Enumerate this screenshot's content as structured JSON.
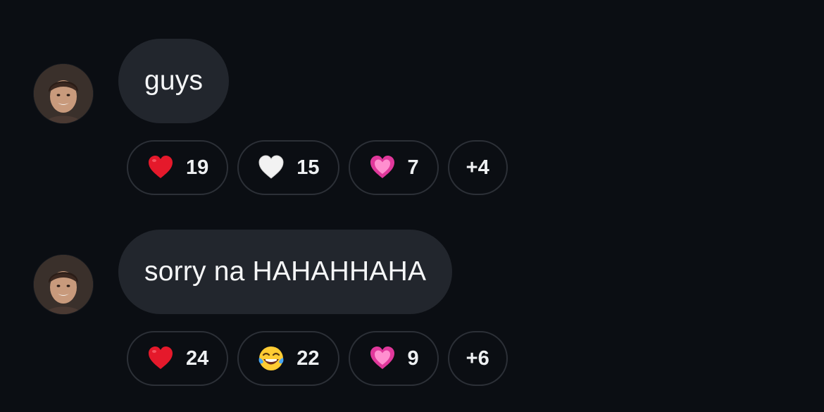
{
  "messages": [
    {
      "avatar": "user-photo-avatar",
      "text": "guys",
      "reactions": [
        {
          "emoji": "red-heart",
          "count": "19"
        },
        {
          "emoji": "white-heart",
          "count": "15"
        },
        {
          "emoji": "pink-heart",
          "count": "7"
        }
      ],
      "more": "+4"
    },
    {
      "avatar": "user-photo-avatar",
      "text": "sorry na HAHAHHAHA",
      "reactions": [
        {
          "emoji": "red-heart",
          "count": "24"
        },
        {
          "emoji": "laughing-tears",
          "count": "22"
        },
        {
          "emoji": "pink-heart",
          "count": "9"
        }
      ],
      "more": "+6"
    }
  ],
  "colors": {
    "background": "#0b0e13",
    "bubble": "#22262d",
    "reaction_border": "#2c3037",
    "text": "#f2f3f5",
    "red_heart": "#e5192b",
    "pink_heart": "#f05fb4"
  }
}
